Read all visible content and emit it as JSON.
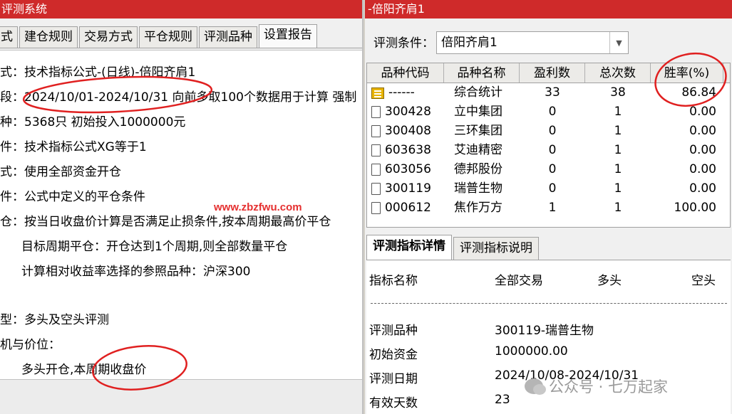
{
  "left": {
    "title": "评测系统",
    "tabs": [
      "式",
      "建仓规则",
      "交易方式",
      "平仓规则",
      "评测品种",
      "设置报告"
    ],
    "lines": [
      "式：技术指标公式-(日线)-倍阳齐肩1",
      "段：2024/10/01-2024/10/31 向前多取100个数据用于计算 强制",
      "种：5368只 初始投入1000000元",
      "件：技术指标公式XG等于1",
      "式：使用全部资金开仓",
      "件：公式中定义的平仓条件",
      "仓：按当日收盘价计算是否满足止损条件,按本周期最高价平仓",
      "目标周期平仓：开仓达到1个周期,则全部数量平仓",
      "计算相对收益率选择的参照品种：沪深300",
      "型：多头及空头评测",
      "机与价位：",
      "多头开仓,本周期收盘价"
    ]
  },
  "right": {
    "title": "-倍阳齐肩1",
    "condition_label": "评测条件：",
    "condition_value": "倍阳齐肩1",
    "columns": [
      "品种代码",
      "品种名称",
      "盈利数",
      "总次数",
      "胜率(%)"
    ],
    "rows": [
      {
        "code": "------",
        "name": "综合统计",
        "profit": "33",
        "total": "38",
        "rate": "86.84"
      },
      {
        "code": "300428",
        "name": "立中集团",
        "profit": "0",
        "total": "1",
        "rate": "0.00"
      },
      {
        "code": "300408",
        "name": "三环集团",
        "profit": "0",
        "total": "1",
        "rate": "0.00"
      },
      {
        "code": "603638",
        "name": "艾迪精密",
        "profit": "0",
        "total": "1",
        "rate": "0.00"
      },
      {
        "code": "603056",
        "name": "德邦股份",
        "profit": "0",
        "total": "1",
        "rate": "0.00"
      },
      {
        "code": "300119",
        "name": "瑞普生物",
        "profit": "0",
        "total": "1",
        "rate": "0.00"
      },
      {
        "code": "000612",
        "name": "焦作万方",
        "profit": "1",
        "total": "1",
        "rate": "100.00"
      }
    ],
    "detail_tabs": [
      "评测指标详情",
      "评测指标说明"
    ],
    "detail_headers": [
      "指标名称",
      "全部交易",
      "多头",
      "空头"
    ],
    "detail_rows": [
      {
        "label": "评测品种",
        "value": "300119-瑞普生物"
      },
      {
        "label": "初始资金",
        "value": "1000000.00"
      },
      {
        "label": "评测日期",
        "value": "2024/10/08-2024/10/31"
      },
      {
        "label": "有效天数",
        "value": "23"
      }
    ]
  },
  "watermark": "www.zbzfwu.com",
  "wechat_text": "公众号 · 七万起家",
  "colors": {
    "titlebar": "#cf2a2a",
    "annotation_circle": "#e02020"
  }
}
